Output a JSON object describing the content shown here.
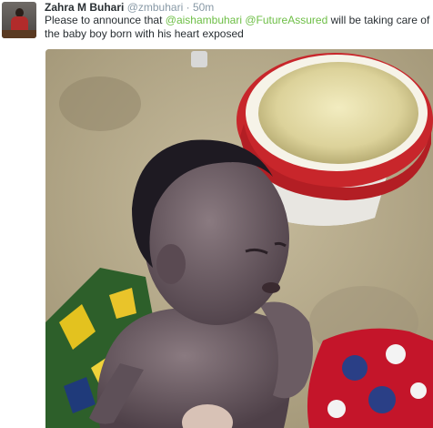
{
  "tweet": {
    "author_name": "Zahra M Buhari",
    "author_handle": "@zmbuhari",
    "separator": "·",
    "timestamp": "50m",
    "text_before": "Please to announce that ",
    "mention_1": "@aishambuhari",
    "text_between": " ",
    "mention_2": "@FutureAssured",
    "text_after": " will be taking care of the baby boy born with his heart exposed",
    "mention_color": "#6dbe45"
  }
}
